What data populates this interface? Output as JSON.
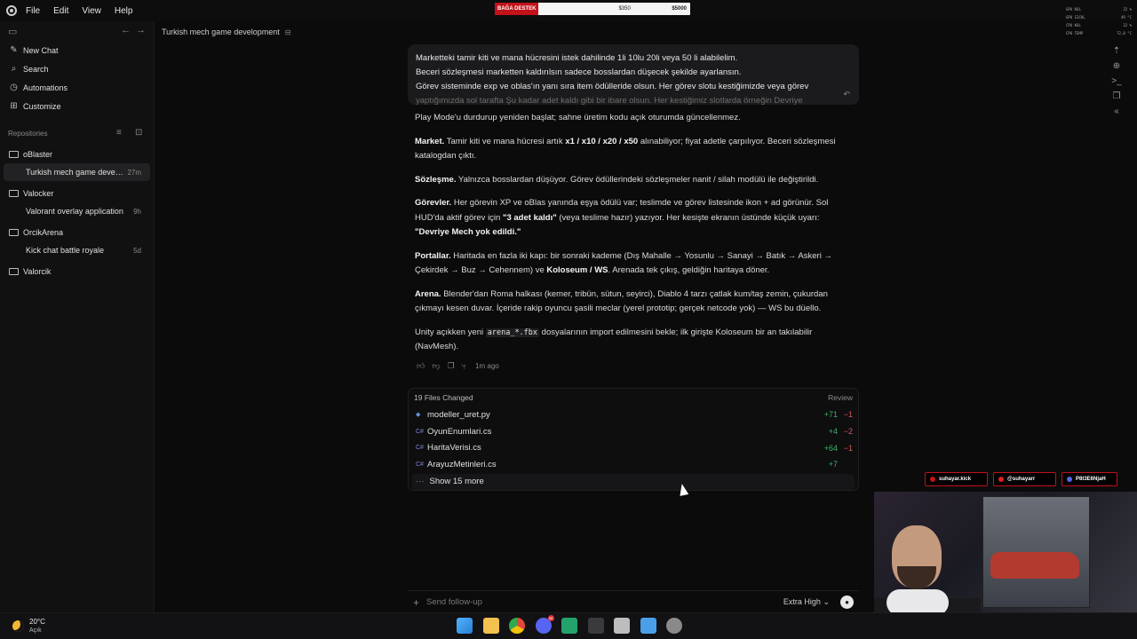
{
  "menu": [
    "File",
    "Edit",
    "View",
    "Help"
  ],
  "top_banner": {
    "left": "BAĞA DESTEK",
    "middle": "$350",
    "right": "$5000"
  },
  "hw_overlay": [
    {
      "label": "GPU KUL",
      "value": "22 %"
    },
    {
      "label": "GPU SICKL",
      "value": "49 °C"
    },
    {
      "label": "CPU KUL",
      "value": "22 %"
    },
    {
      "label": "CPU TEMP",
      "value": "72,8 °C"
    }
  ],
  "sidebar": {
    "nav": [
      {
        "label": "New Chat",
        "icon": "edit-icon"
      },
      {
        "label": "Search",
        "icon": "search-icon"
      },
      {
        "label": "Automations",
        "icon": "clock-icon"
      },
      {
        "label": "Customize",
        "icon": "customize-icon"
      }
    ],
    "repos_label": "Repositories",
    "groups": [
      {
        "name": "oBlaster",
        "chats": [
          {
            "title": "Turkish mech game develop...",
            "time": "27m",
            "active": true
          }
        ]
      },
      {
        "name": "Valocker",
        "chats": [
          {
            "title": "Valorant overlay application",
            "time": "9h",
            "active": false
          }
        ]
      },
      {
        "name": "OrcikArena",
        "chats": [
          {
            "title": "Kick chat battle royale",
            "time": "5d",
            "active": false
          }
        ]
      },
      {
        "name": "Valorcik",
        "chats": []
      }
    ]
  },
  "header": {
    "title": "Turkish mech game development"
  },
  "user_message": {
    "lines": [
      "Marketteki tamir kiti ve mana hücresini istek dahilinde 1li 10lu 20li veya 50 li alabilelim.",
      "Beceri sözleşmesi marketten kaldırılsın sadece bosslardan düşecek şekilde ayarlansın.",
      "Görev sisteminde exp ve oblas'ın yanı sıra item ödülleride olsun. Her görev slotu kestiğimizde veya görev",
      "yaptığımızda sol tarafta Şu kadar adet kaldı gibi bir ibare olsun. Her kestiğimiz slotlarda örneğin Devriye"
    ]
  },
  "response": {
    "intro": "Play Mode'u durdurup yeniden başlat; sahne üretim kodu açık oturumda güncellenmez.",
    "market": {
      "title": "Market.",
      "t1": " Tamir kiti ve mana hücresi artık ",
      "b1": "x1 / x10 / x20 / x50",
      "t2": " alınabiliyor; fiyat adetle çarpılıyor. Beceri sözleşmesi katalogdan çıktı."
    },
    "sozlesme": {
      "title": "Sözleşme.",
      "t1": " Yalnızca bosslardan düşüyor. Görev ödüllerindeki sözleşmeler nanit / silah modülü ile değiştirildi."
    },
    "gorevler": {
      "title": "Görevler.",
      "t1": " Her görevin XP ve oBlas yanında eşya ödülü var; teslimde ve görev listesinde ikon + ad görünür. Sol HUD'da aktif görev için ",
      "b1": "\"3 adet kaldı\"",
      "t2": " (veya teslime hazır) yazıyor. Her kesişte ekranın üstünde küçük uyarı: ",
      "b2": "\"Devriye Mech yok edildi.\""
    },
    "portallar": {
      "title": "Portallar.",
      "t1": " Haritada en fazla iki kapı: bir sonraki kademe (Dış Mahalle → Yosunlu → Sanayi → Batık → Askeri → Çekirdek → Buz → Cehennem) ve ",
      "b1": "Koloseum / WS",
      "t2": ". Arenada tek çıkış, geldiğin haritaya döner."
    },
    "arena": {
      "title": "Arena.",
      "t1": " Blender'dan Roma halkası (kemer, tribün, sütun, seyirci), Diablo 4 tarzı çatlak kum/taş zemin, çukurdan çıkmayı kesen duvar. İçeride rakip oyuncu şasili meclar (yerel prototip; gerçek netcode yok) — WS bu düello."
    },
    "unity": {
      "t1": "Unity açıkken yeni ",
      "code": "arena_*.fbx",
      "t2": " dosyalarının import edilmesini bekle; ilk girişte Koloseum bir an takılabilir (NavMesh)."
    }
  },
  "actions": {
    "timestamp": "1m ago"
  },
  "files": {
    "header": "19 Files Changed",
    "review": "Review",
    "rows": [
      {
        "name": "modeller_uret.py",
        "add": "+71",
        "del": "−1",
        "type": "py"
      },
      {
        "name": "OyunEnumlari.cs",
        "add": "+4",
        "del": "−2",
        "type": "cs"
      },
      {
        "name": "HaritaVerisi.cs",
        "add": "+64",
        "del": "−1",
        "type": "cs"
      },
      {
        "name": "ArayuzMetinleri.cs",
        "add": "+7",
        "del": "",
        "type": "cs"
      }
    ],
    "show_more": "Show 15 more"
  },
  "stream_tags": [
    {
      "label": "suhayar.kick",
      "dot": "#c2121a"
    },
    {
      "label": "@suhayarr",
      "dot": "#e02020"
    },
    {
      "label": "P8t3E6NjaH",
      "dot": "#5865f2"
    }
  ],
  "composer": {
    "placeholder": "Send follow-up",
    "effort": "Extra High"
  },
  "weather": {
    "temp": "20°C",
    "desc": "Açık"
  },
  "taskbar_apps": [
    {
      "name": "windows-start-icon",
      "color": "#3aa3f0"
    },
    {
      "name": "file-explorer-icon",
      "color": "#f2c14e"
    },
    {
      "name": "chrome-icon",
      "color": "#e5473b"
    },
    {
      "name": "discord-icon",
      "color": "#5865f2",
      "badge": "99"
    },
    {
      "name": "app-icon",
      "color": "#23a36b"
    },
    {
      "name": "obs-icon",
      "color": "#3a3a3e"
    },
    {
      "name": "unity-icon",
      "color": "#bdbdbd"
    },
    {
      "name": "notepad-icon",
      "color": "#4aa0e8"
    },
    {
      "name": "settings-icon",
      "color": "#8a8a8a"
    }
  ]
}
